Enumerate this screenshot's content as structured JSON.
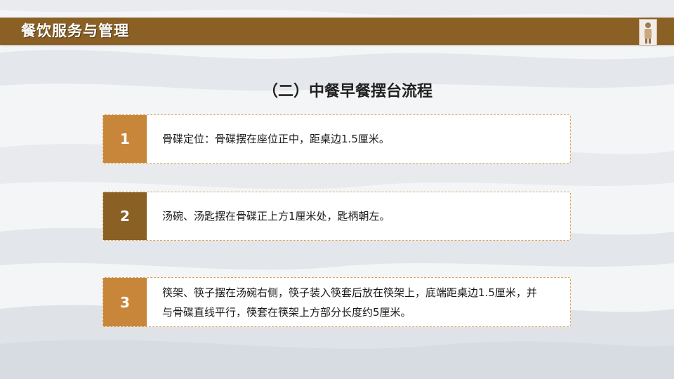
{
  "header": {
    "title": "餐饮服务与管理"
  },
  "slide": {
    "title": "（二）中餐早餐摆台流程"
  },
  "steps": [
    {
      "num": "1",
      "text": "骨碟定位：骨碟摆在座位正中，距桌边1.5厘米。",
      "num_color": "#c8863a"
    },
    {
      "num": "2",
      "text": "汤碗、汤匙摆在骨碟正上方1厘米处，匙柄朝左。",
      "num_color": "#8a6024"
    },
    {
      "num": "3",
      "text": "筷架、筷子摆在汤碗右侧，筷子装入筷套后放在筷架上，底端距桌边1.5厘米，并与骨碟直线平行，筷套在筷架上方部分长度约5厘米。",
      "num_color": "#c8863a"
    }
  ],
  "colors": {
    "header_bar": "#8a6024",
    "accent_light": "#c8863a",
    "accent_dark": "#8a6024"
  }
}
